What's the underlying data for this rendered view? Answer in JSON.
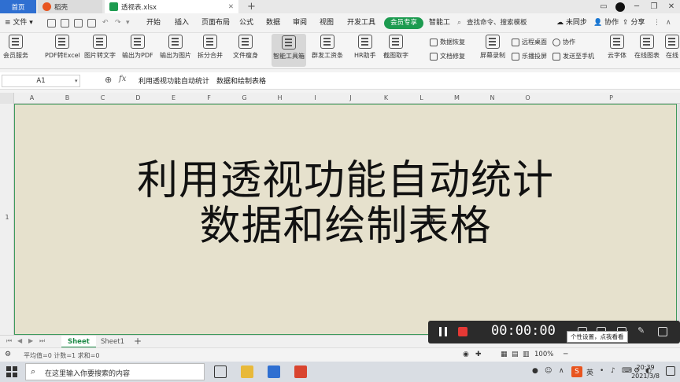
{
  "tabs": {
    "home": "首页",
    "docer": "稻壳",
    "file": "透视表.xlsx"
  },
  "menu": {
    "file": "文件",
    "items": [
      "开始",
      "插入",
      "页面布局",
      "公式",
      "数据",
      "审阅",
      "视图",
      "开发工具"
    ],
    "vip": "会员专享",
    "smart_tools": "智能工",
    "search": "查找命令、搜索模板",
    "unsync": "未同步",
    "collab": "协作",
    "share": "分享"
  },
  "ribbon": {
    "buttons": [
      "会员服务",
      "PDF转Excel",
      "图片转文字",
      "输出为PDF",
      "输出为图片",
      "拆分合并",
      "文件瘦身",
      "智能工具箱",
      "群发工资条",
      "HR助手",
      "截图取字",
      "屏幕录制",
      "云字体",
      "在线图表",
      "在线"
    ],
    "small": {
      "data_recovery": "数据恢复",
      "doc_repair": "文档修复",
      "remote_desktop": "远程桌面",
      "cast": "乐播投屏",
      "collab": "协作",
      "send_phone": "发送至手机"
    }
  },
  "formula_bar": {
    "name_box": "A1",
    "fx": "fx",
    "content": "利用透视功能自动统计　数据和绘制表格"
  },
  "columns": [
    "A",
    "B",
    "C",
    "D",
    "E",
    "F",
    "G",
    "H",
    "I",
    "J",
    "K",
    "L",
    "M",
    "N",
    "O",
    "P"
  ],
  "row_label": "1",
  "cell": {
    "line1": "利用透视功能自动统计",
    "line2": "数据和绘制表格"
  },
  "sheets": {
    "active": "Sheet",
    "other": "Sheet1"
  },
  "status": {
    "summary": "平均值=0  计数=1  求和=0",
    "zoom": "100%"
  },
  "recorder": {
    "time": "00:00:00",
    "tooltip": "个性设置，点我看看"
  },
  "taskbar": {
    "search_placeholder": "在这里输入你要搜索的内容",
    "time": "20:39",
    "date": "2021/3/8",
    "ime": "英"
  },
  "colors": {
    "accent_blue": "#2f6fd1",
    "vip_green": "#1d9b50",
    "cell_bg": "#e6e1cd",
    "selection": "#3e9a5c"
  }
}
